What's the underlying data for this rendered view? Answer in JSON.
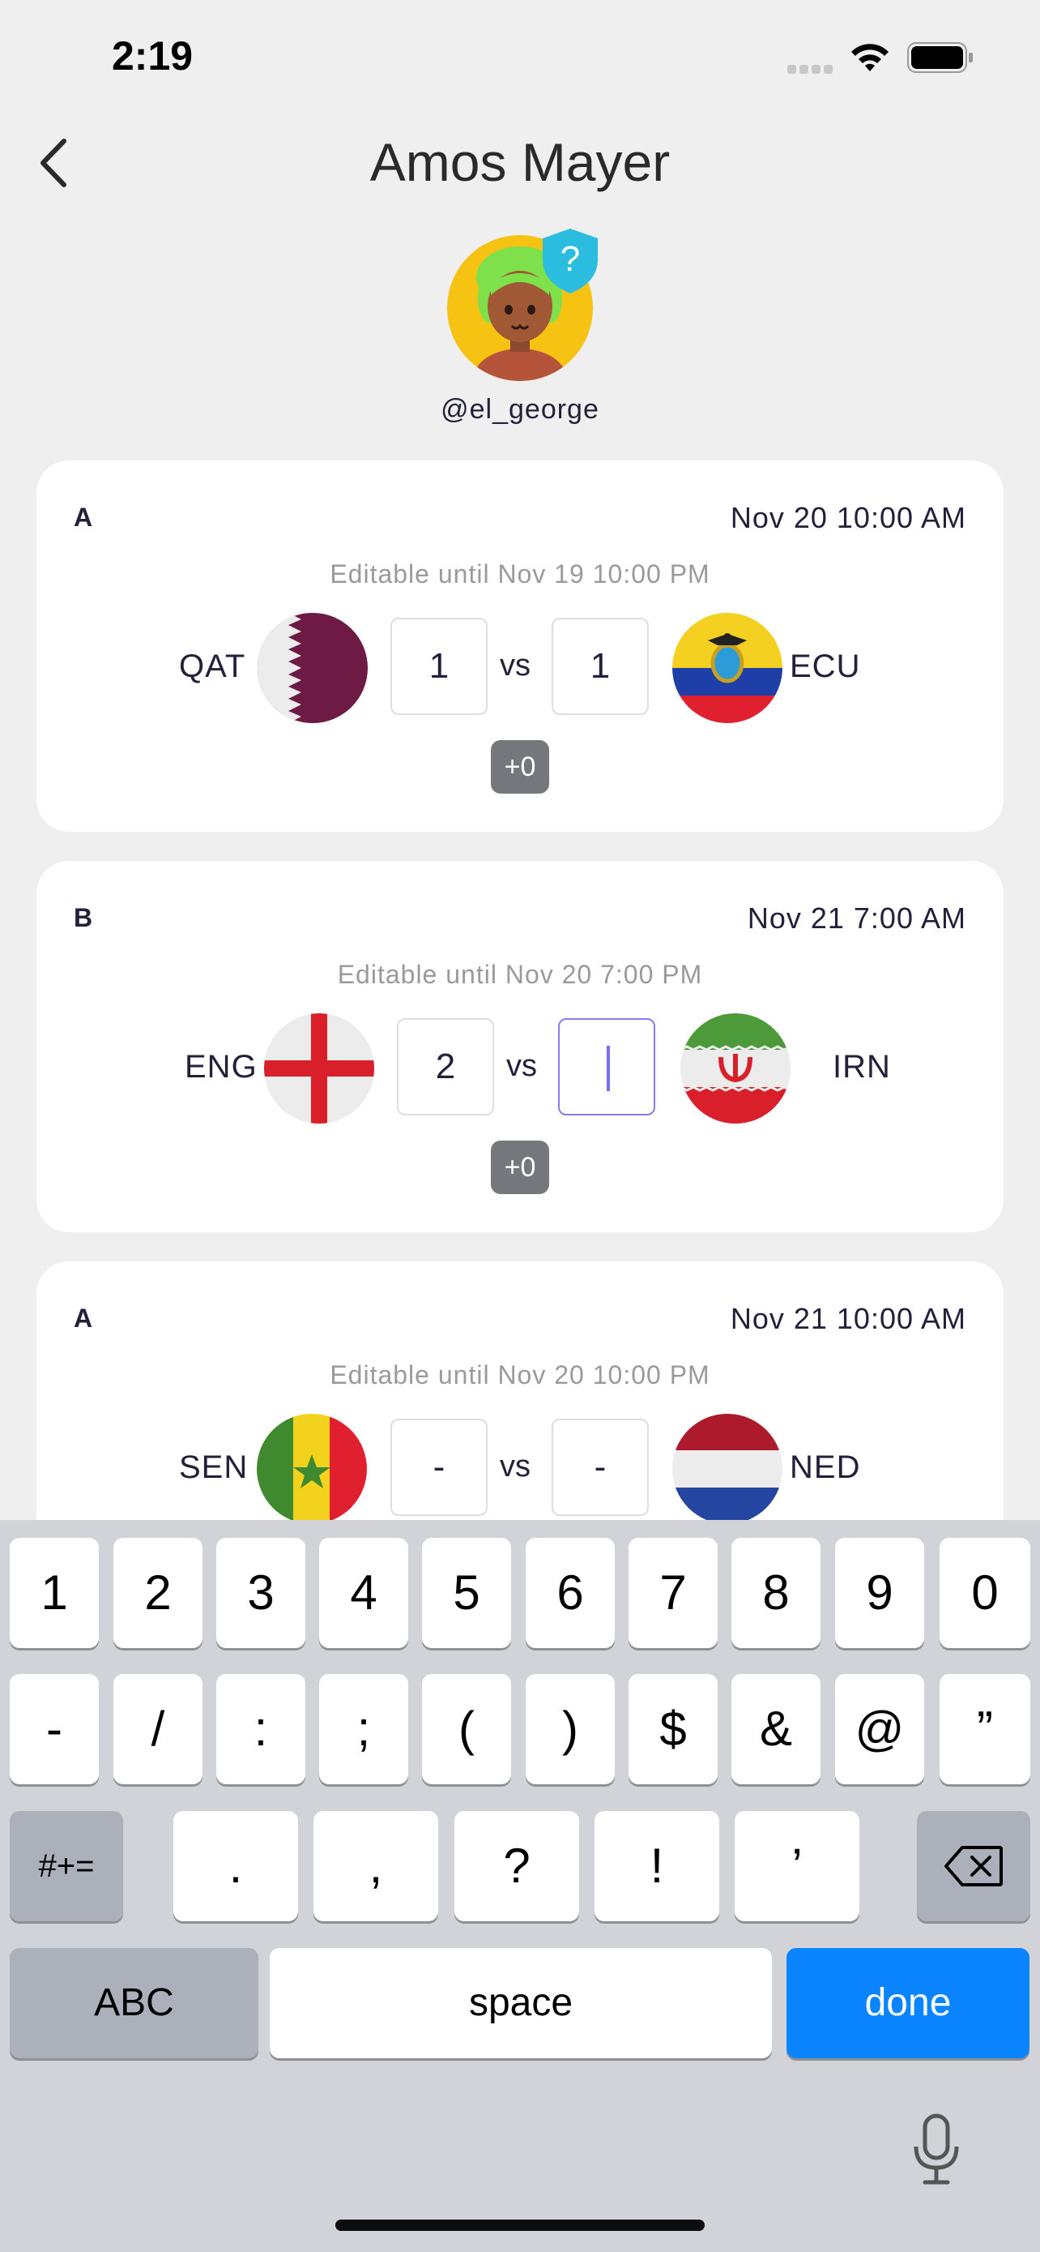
{
  "status_bar": {
    "time": "2:19"
  },
  "header": {
    "title": "Amos Mayer",
    "username": "@el_george",
    "badge_symbol": "?"
  },
  "matches": [
    {
      "group": "A",
      "kickoff": "Nov 20 10:00 AM",
      "editable_until": "Editable until Nov 19 10:00 PM",
      "home_code": "QAT",
      "away_code": "ECU",
      "home_score": "1",
      "away_score": "1",
      "vs": "vs",
      "points": "+0"
    },
    {
      "group": "B",
      "kickoff": "Nov 21 7:00 AM",
      "editable_until": "Editable until Nov 20 7:00 PM",
      "home_code": "ENG",
      "away_code": "IRN",
      "home_score": "2",
      "away_score": "",
      "vs": "vs",
      "points": "+0"
    },
    {
      "group": "A",
      "kickoff": "Nov 21 10:00 AM",
      "editable_until": "Editable until Nov 20 10:00 PM",
      "home_code": "SEN",
      "away_code": "NED",
      "home_score": "-",
      "away_score": "-",
      "vs": "vs"
    }
  ],
  "keyboard": {
    "row1": [
      "1",
      "2",
      "3",
      "4",
      "5",
      "6",
      "7",
      "8",
      "9",
      "0"
    ],
    "row2": [
      "-",
      "/",
      ":",
      ";",
      "(",
      ")",
      "$",
      "&",
      "@",
      "”"
    ],
    "row3": {
      "mode": "#+=",
      "keys": [
        ".",
        ",",
        "?",
        "!",
        "’"
      ]
    },
    "row4": {
      "abc": "ABC",
      "space": "space",
      "done": "done"
    }
  },
  "colors": {
    "accent_purple": "#8a7cf0",
    "keyboard_done": "#0a84ff",
    "badge": "#2bbde0"
  }
}
